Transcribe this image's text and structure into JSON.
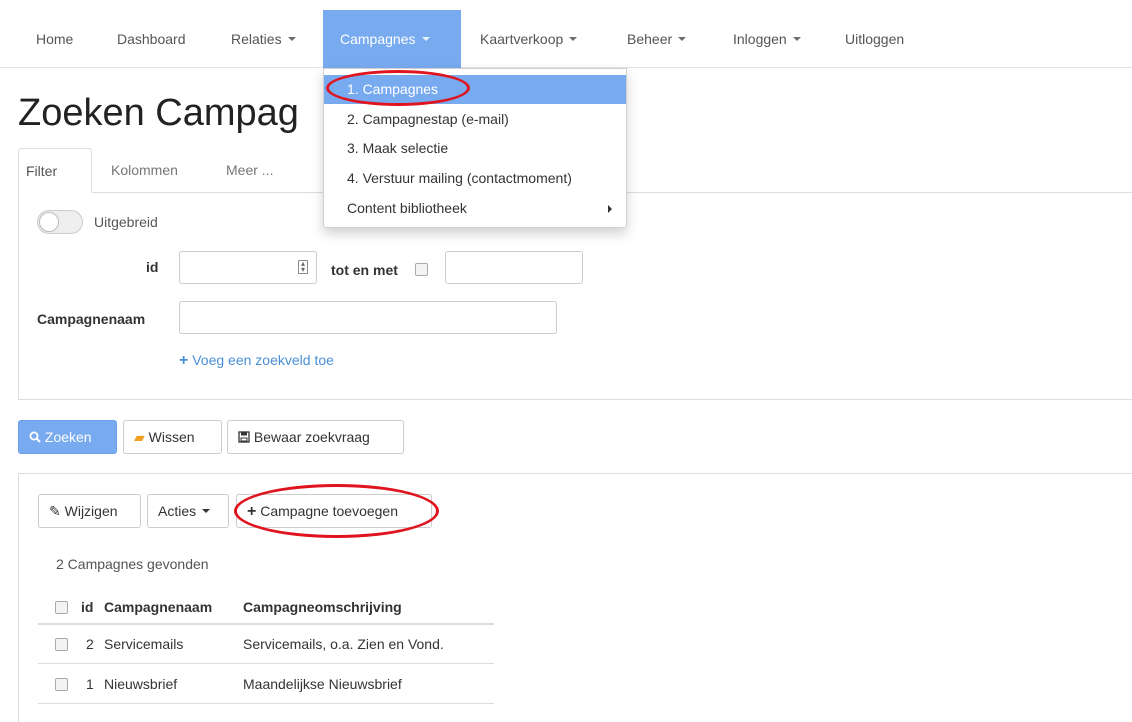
{
  "navbar": {
    "items": [
      {
        "label": "Home",
        "has_caret": false
      },
      {
        "label": "Dashboard",
        "has_caret": false
      },
      {
        "label": "Relaties",
        "has_caret": true
      },
      {
        "label": "Campagnes",
        "has_caret": true,
        "active": true
      },
      {
        "label": "Kaartverkoop",
        "has_caret": true
      },
      {
        "label": "Beheer",
        "has_caret": true
      },
      {
        "label": "Inloggen",
        "has_caret": true
      },
      {
        "label": "Uitloggen",
        "has_caret": false
      }
    ]
  },
  "dropdown": {
    "items": [
      {
        "label": "1. Campagnes",
        "active": true
      },
      {
        "label": "2. Campagnestap (e-mail)"
      },
      {
        "label": "3. Maak selectie"
      },
      {
        "label": "4. Verstuur mailing (contactmoment)"
      },
      {
        "label": "Content bibliotheek",
        "has_submenu": true
      }
    ]
  },
  "page": {
    "title": "Zoeken Campag"
  },
  "tabs": [
    {
      "label": "Filter",
      "active": true
    },
    {
      "label": "Kolommen"
    },
    {
      "label": "Meer ..."
    }
  ],
  "filter": {
    "toggle_label": "Uitgebreid",
    "id_label": "id",
    "id_value": "",
    "range_label": "tot en met",
    "range_value": "",
    "name_label": "Campagnenaam",
    "name_value": "",
    "add_field_link": "Voeg een zoekveld toe"
  },
  "actions": {
    "search": "Zoeken",
    "clear": "Wissen",
    "save_query": "Bewaar zoekvraag"
  },
  "results": {
    "edit": "Wijzigen",
    "actions": "Acties",
    "add": "Campagne toevoegen",
    "count_text": "2 Campagnes gevonden",
    "columns": [
      "id",
      "Campagnenaam",
      "Campagneomschrijving"
    ],
    "rows": [
      {
        "id": "2",
        "name": "Servicemails",
        "description": "Servicemails, o.a. Zien en Vond."
      },
      {
        "id": "1",
        "name": "Nieuwsbrief",
        "description": "Maandelijkse Nieuwsbrief"
      }
    ]
  },
  "colors": {
    "accent": "#78aaf0",
    "link": "#4a90d9",
    "annotation": "#e0141e"
  }
}
